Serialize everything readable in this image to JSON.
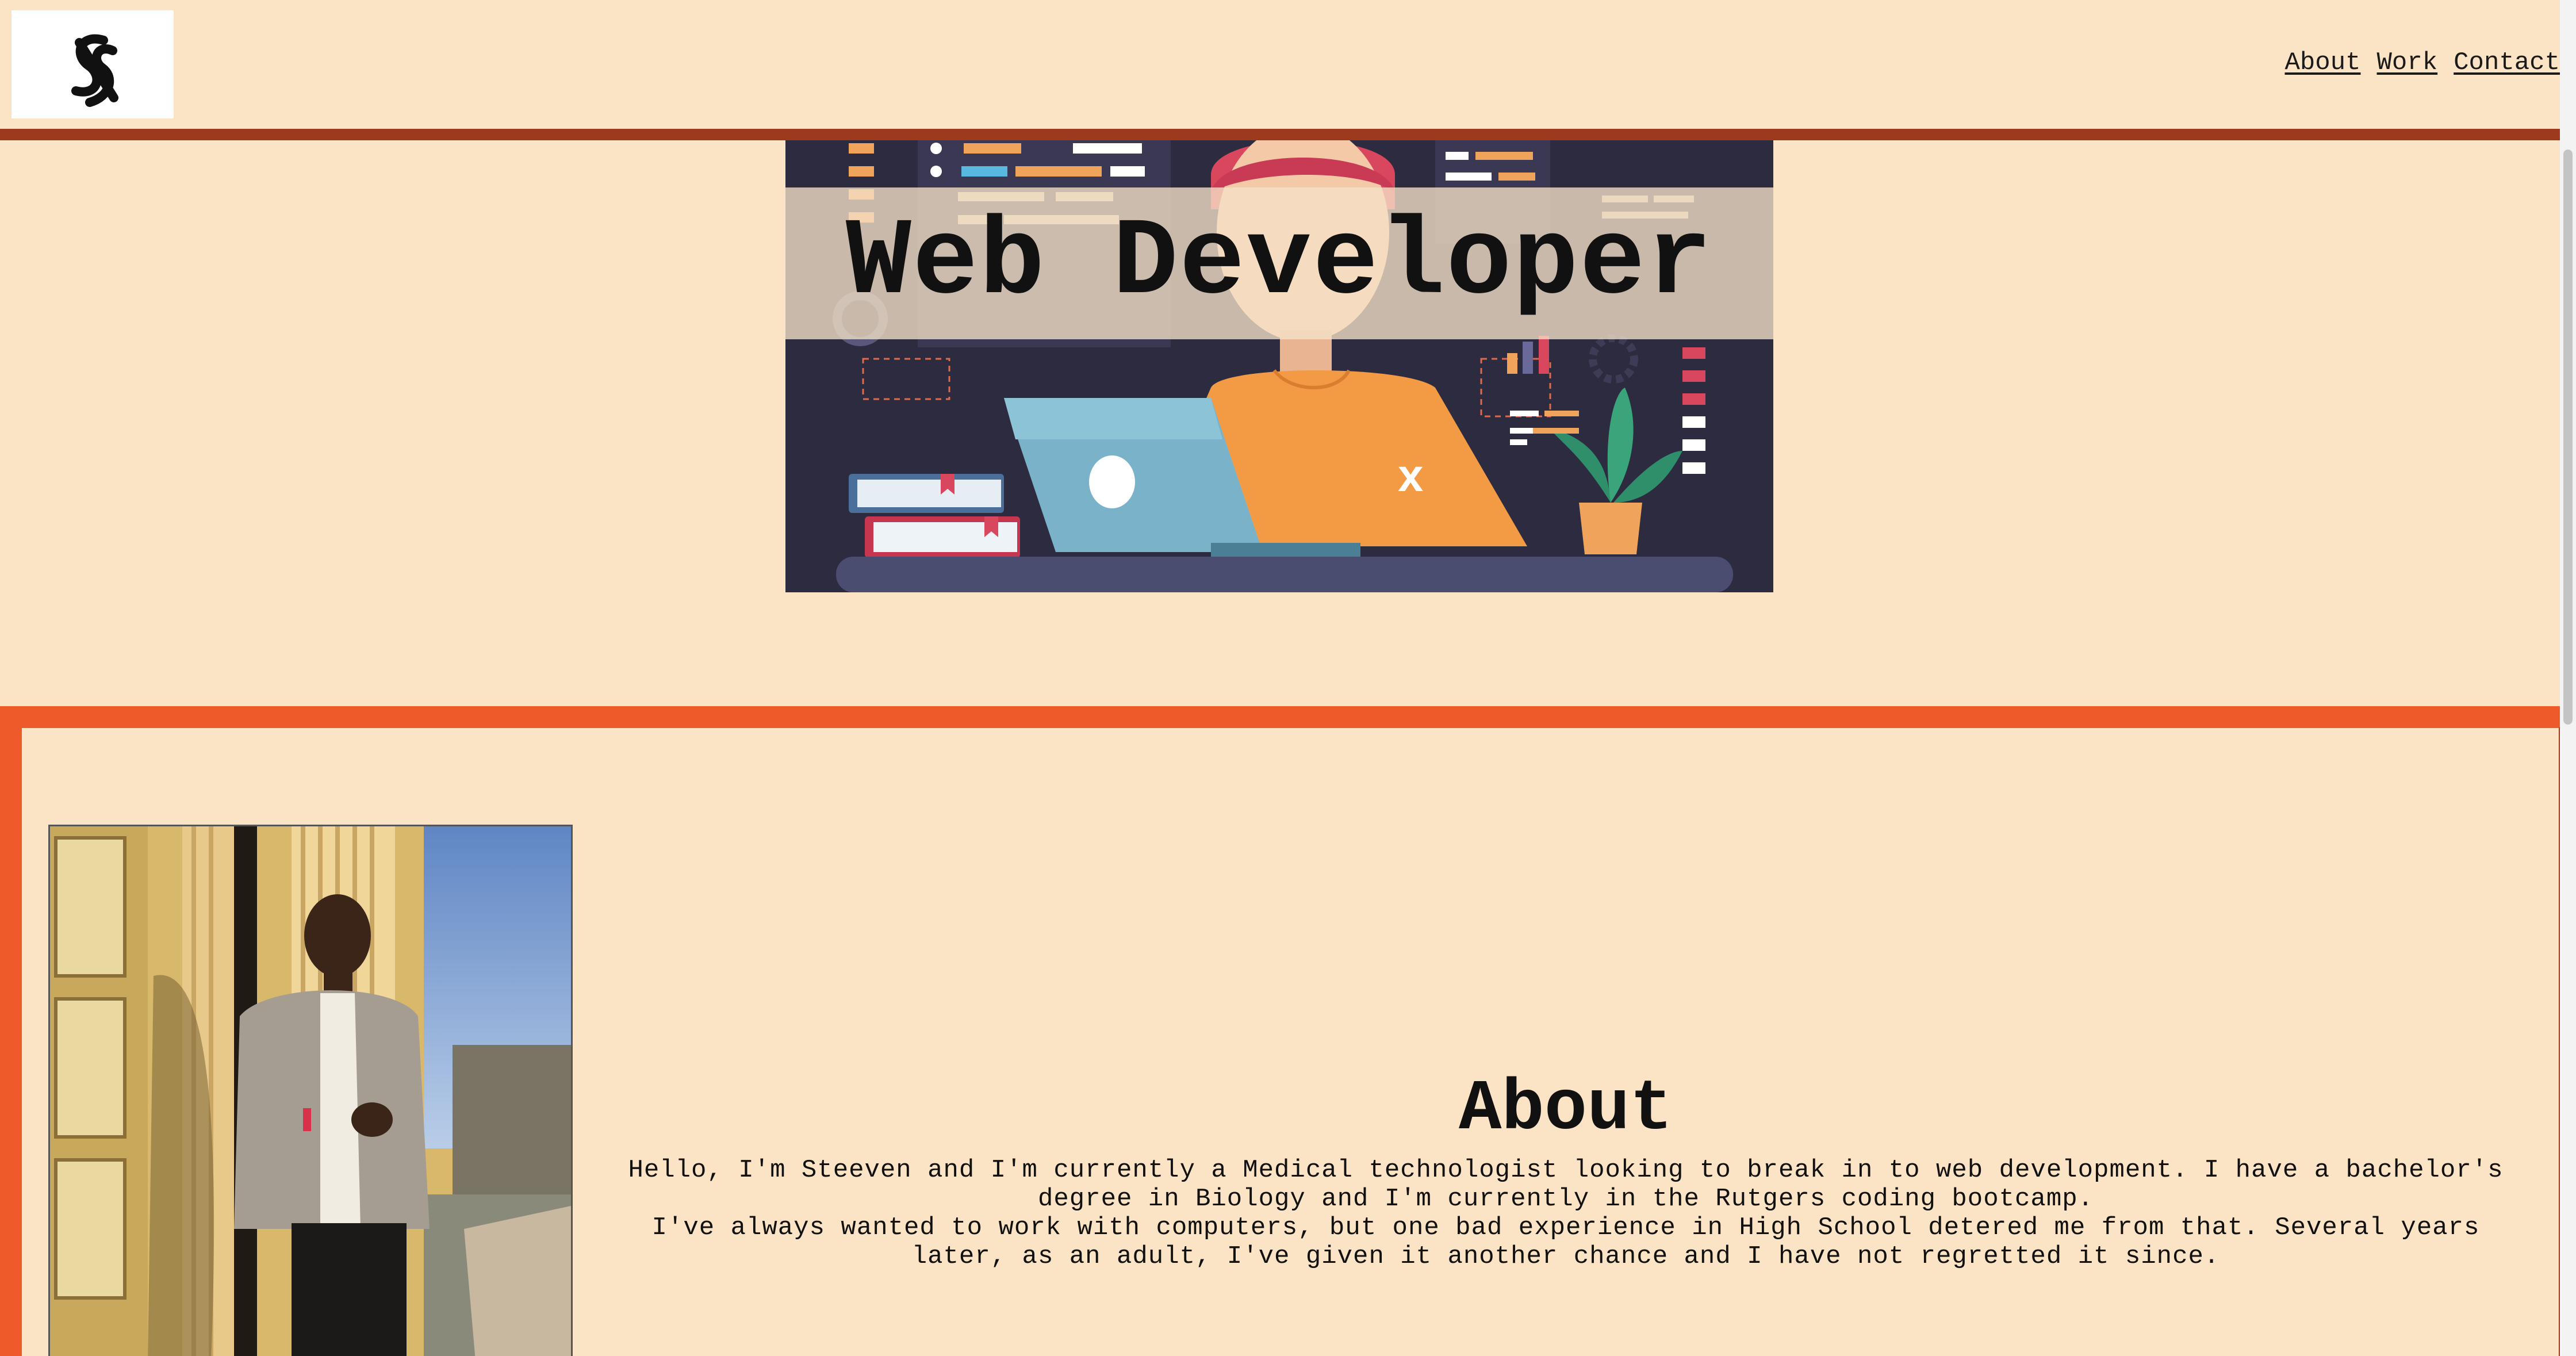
{
  "header": {
    "nav": [
      {
        "label": "About"
      },
      {
        "label": "Work"
      },
      {
        "label": "Contact"
      }
    ]
  },
  "hero": {
    "title": "Web Developer"
  },
  "about": {
    "title": "About",
    "paragraphs": [
      "Hello, I'm Steeven and I'm currently a Medical technologist looking to break in to web development. I have a bachelor's degree in Biology and I'm currently in the Rutgers coding bootcamp.",
      "I've always wanted to work with computers, but one bad experience in High School detered me from that. Several years later, as an adult, I've given it another chance and I have not regretted it since."
    ]
  },
  "colors": {
    "background": "#fbe3c5",
    "header_border": "#9c3a1b",
    "section_border": "#ef5a2b",
    "hero_bg": "#2d2b40"
  }
}
